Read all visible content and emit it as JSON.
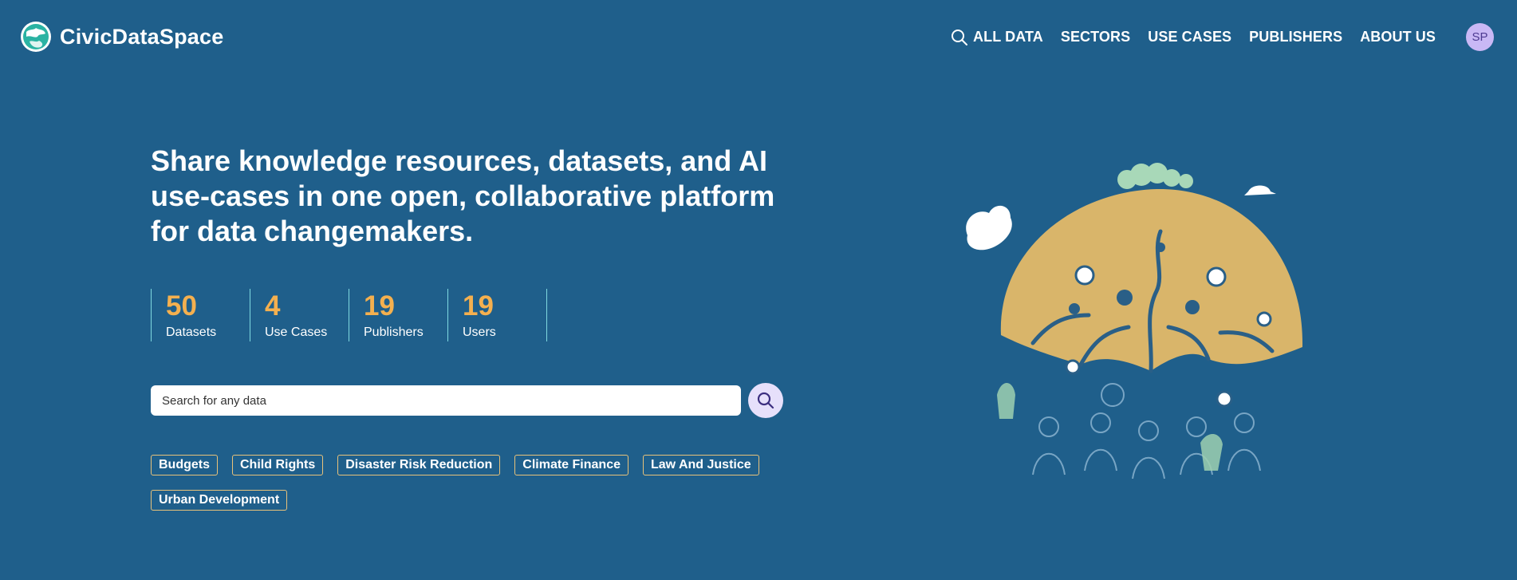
{
  "header": {
    "brand": "CivicDataSpace",
    "nav": [
      {
        "label": "ALL DATA"
      },
      {
        "label": "SECTORS"
      },
      {
        "label": "USE CASES"
      },
      {
        "label": "PUBLISHERS"
      },
      {
        "label": "ABOUT US"
      }
    ],
    "avatar_initials": "SP"
  },
  "hero": {
    "headline": "Share knowledge resources, datasets, and AI use-cases in one open, collaborative platform for data changemakers."
  },
  "stats": [
    {
      "value": "50",
      "label": "Datasets"
    },
    {
      "value": "4",
      "label": "Use Cases"
    },
    {
      "value": "19",
      "label": "Publishers"
    },
    {
      "value": "19",
      "label": "Users"
    }
  ],
  "search": {
    "placeholder": "Search for any data",
    "value": ""
  },
  "tags": [
    {
      "label": "Budgets"
    },
    {
      "label": "Child Rights"
    },
    {
      "label": "Disaster Risk Reduction"
    },
    {
      "label": "Climate Finance"
    },
    {
      "label": "Law And Justice"
    },
    {
      "label": "Urban Development"
    }
  ],
  "icons": {
    "nav_search": "search-icon",
    "search_button": "search-icon",
    "logo": "globe-logo-icon"
  },
  "colors": {
    "background": "#1f5f8b",
    "stat_value": "#f4b04f",
    "stat_divider": "#7fd9e0",
    "tag_border": "#e8c27a",
    "avatar_bg": "#c9b8f5"
  }
}
